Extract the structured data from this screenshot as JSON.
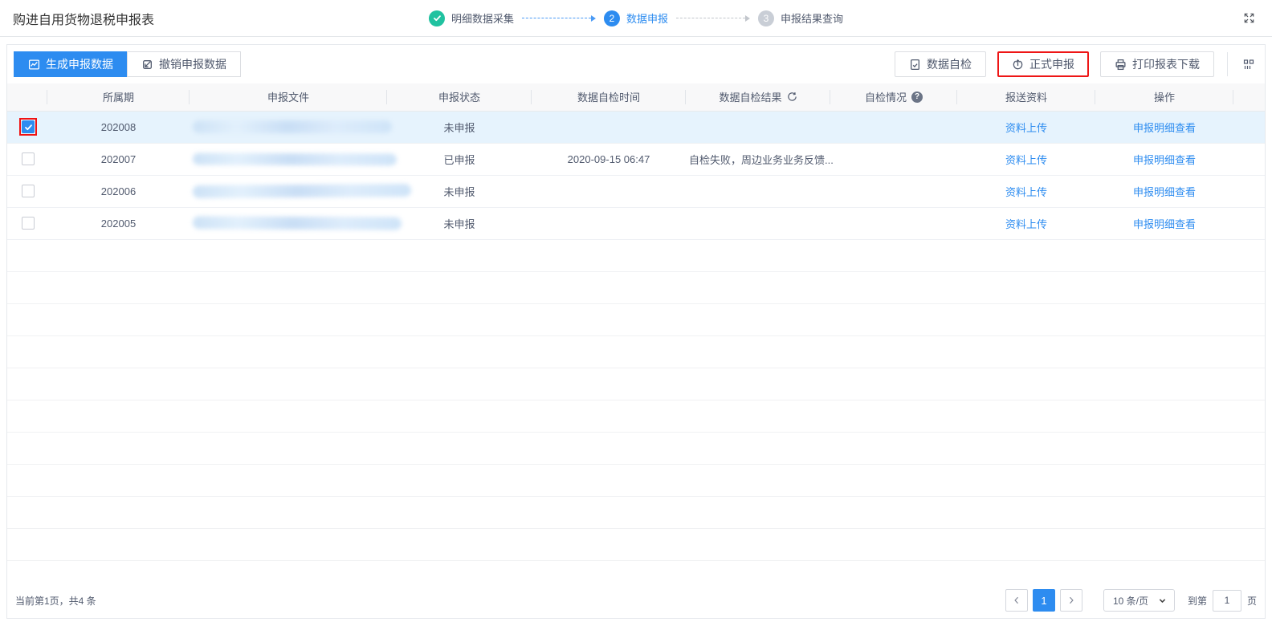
{
  "header": {
    "title": "购进自用货物退税申报表"
  },
  "steps": [
    {
      "label": "明细数据采集",
      "state": "done"
    },
    {
      "label": "数据申报",
      "number": "2",
      "state": "active"
    },
    {
      "label": "申报结果查询",
      "number": "3",
      "state": "pending"
    }
  ],
  "toolbar": {
    "generate": "生成申报数据",
    "revoke": "撤销申报数据",
    "self_check": "数据自检",
    "formal_submit": "正式申报",
    "print_download": "打印报表下载"
  },
  "table": {
    "columns": [
      "",
      "所属期",
      "申报文件",
      "申报状态",
      "数据自检时间",
      "数据自检结果",
      "自检情况",
      "报送资料",
      "操作"
    ],
    "help_glyph": "?",
    "rows": [
      {
        "period": "202008",
        "selected": true,
        "status": "未申报",
        "self_check_time": "",
        "self_check_result": "",
        "upload": "资料上传",
        "detail": "申报明细查看"
      },
      {
        "period": "202007",
        "selected": false,
        "status": "已申报",
        "self_check_time": "2020-09-15 06:47",
        "self_check_result": "自检失败，周边业务业务反馈...",
        "upload": "资料上传",
        "detail": "申报明细查看"
      },
      {
        "period": "202006",
        "selected": false,
        "status": "未申报",
        "self_check_time": "",
        "self_check_result": "",
        "upload": "资料上传",
        "detail": "申报明细查看"
      },
      {
        "period": "202005",
        "selected": false,
        "status": "未申报",
        "self_check_time": "",
        "self_check_result": "",
        "upload": "资料上传",
        "detail": "申报明细查看"
      }
    ]
  },
  "pagination": {
    "summary": "当前第1页，共4 条",
    "current_page": "1",
    "page_size": "10 条/页",
    "goto_label": "到第",
    "goto_value": "1",
    "goto_unit": "页"
  },
  "icons": {
    "generate": "line-chart-icon",
    "revoke": "undo-box-icon",
    "self_check": "document-check-icon",
    "formal_submit": "upload-arrow-icon",
    "print_download": "printer-icon",
    "column_settings": "column-grid-icon",
    "fullscreen": "expand-arrows-icon",
    "refresh": "refresh-icon",
    "help": "question-circle-icon",
    "check": "check-icon"
  },
  "colors": {
    "primary": "#2d8cf0",
    "success_teal": "#20c2a0",
    "pending_gray": "#c9ced6",
    "annotation_red": "#ee1616",
    "selected_row": "#e6f3fd",
    "link": "#2d8cf0",
    "header_bg": "#f8f8f9"
  }
}
